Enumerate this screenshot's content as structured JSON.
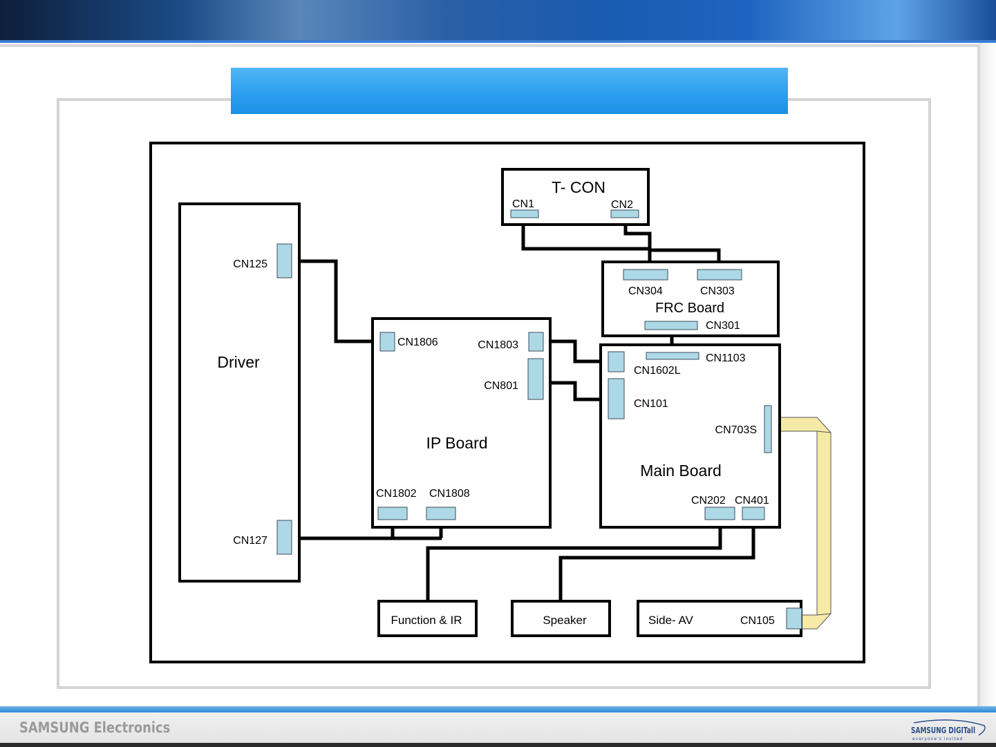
{
  "slide": {
    "title": ""
  },
  "footer": {
    "company": "SAMSUNG Electronics",
    "logo_main": "SAMSUNG DIGITall",
    "logo_tagline": "everyone's invited"
  },
  "diagram": {
    "boards": {
      "driver": "Driver",
      "ip_board": "IP Board",
      "main_board": "Main Board",
      "frc_board": "FRC Board",
      "tcon": "T- CON",
      "function_ir": "Function & IR",
      "speaker": "Speaker",
      "side_av": "Side- AV"
    },
    "connectors": {
      "cn1": "CN1",
      "cn2": "CN2",
      "cn304": "CN304",
      "cn303": "CN303",
      "cn301": "CN301",
      "cn1103": "CN1103",
      "cn125": "CN125",
      "cn127": "CN127",
      "cn1806": "CN1806",
      "cn1803": "CN1803",
      "cn801": "CN801",
      "cn1802": "CN1802",
      "cn1808": "CN1808",
      "cn1602l": "CN1602L",
      "cn101": "CN101",
      "cn703s": "CN703S",
      "cn202": "CN202",
      "cn401": "CN401",
      "cn105": "CN105"
    },
    "colors": {
      "connector_fill": "#add8e6",
      "flex_cable": "#f5eaa6",
      "title_bar": "#2d9ff0"
    }
  }
}
